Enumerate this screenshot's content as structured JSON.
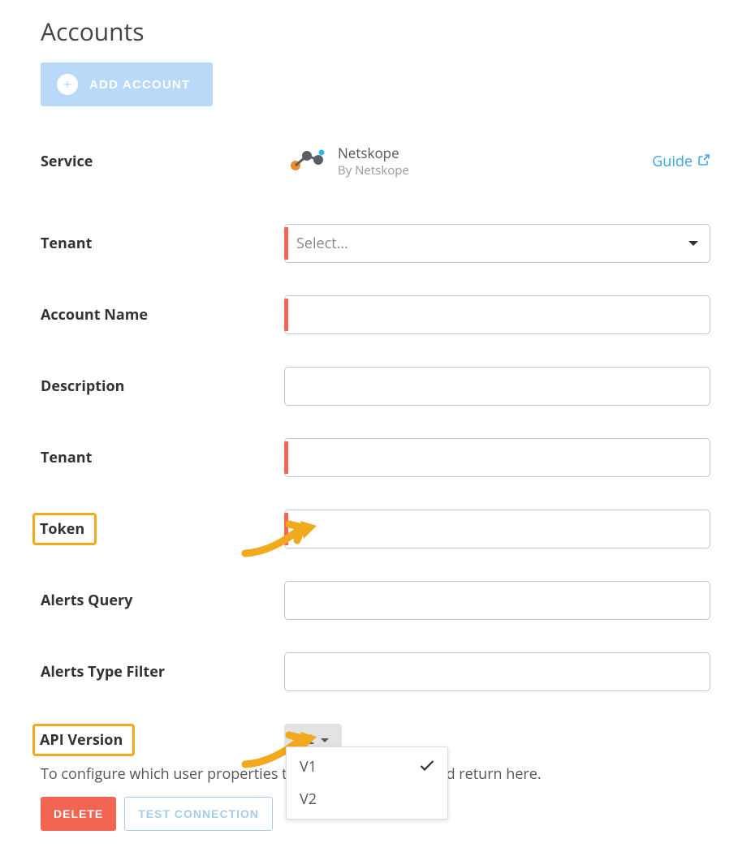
{
  "page": {
    "title": "Accounts"
  },
  "addButton": {
    "label": "ADD ACCOUNT"
  },
  "service": {
    "label": "Service",
    "name": "Netskope",
    "by": "By Netskope",
    "guide": "Guide"
  },
  "fields": {
    "tenantSelect": {
      "label": "Tenant",
      "placeholder": "Select..."
    },
    "accountName": {
      "label": "Account Name"
    },
    "description": {
      "label": "Description"
    },
    "tenantText": {
      "label": "Tenant"
    },
    "token": {
      "label": "Token"
    },
    "alertsQuery": {
      "label": "Alerts Query"
    },
    "alertsTypeFilter": {
      "label": "Alerts Type Filter"
    }
  },
  "apiVersion": {
    "label": "API Version",
    "selected": "V1",
    "options": [
      "V1",
      "V2"
    ]
  },
  "helpText": "To configure which user properties to collect, go to LDAP and return here.",
  "actions": {
    "delete": "DELETE",
    "test": "TEST CONNECTION"
  }
}
